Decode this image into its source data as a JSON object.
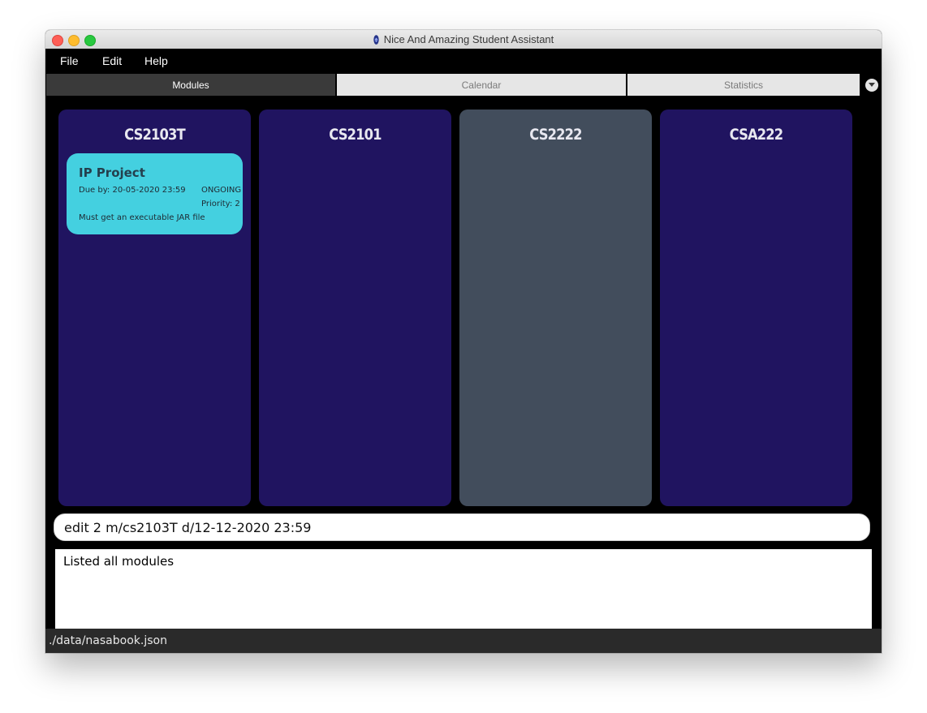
{
  "window": {
    "title": "Nice And Amazing Student Assistant"
  },
  "menu": {
    "items": [
      "File",
      "Edit",
      "Help"
    ]
  },
  "tabs": [
    {
      "label": "Modules",
      "active": true
    },
    {
      "label": "Calendar",
      "active": false
    },
    {
      "label": "Statistics",
      "active": false
    }
  ],
  "modules": [
    {
      "code": "CS2103T",
      "selected": false,
      "tasks": [
        {
          "name": "IP Project",
          "due": "Due by: 20-05-2020 23:59",
          "status": "ONGOING",
          "priority": "Priority: 2",
          "description": "Must get an executable JAR file"
        }
      ]
    },
    {
      "code": "CS2101",
      "selected": false,
      "tasks": []
    },
    {
      "code": "CS2222",
      "selected": true,
      "tasks": []
    },
    {
      "code": "CSA222",
      "selected": false,
      "tasks": []
    }
  ],
  "command": {
    "value": "edit 2 m/cs2103T d/12-12-2020 23:59"
  },
  "result": {
    "text": "Listed all modules"
  },
  "status": {
    "file_path": "./data/nasabook.json"
  },
  "colors": {
    "module_bg": "#201460",
    "module_selected_bg": "#424d5c",
    "task_card": "#44d0e0",
    "status_bar": "#2a2a2a"
  }
}
